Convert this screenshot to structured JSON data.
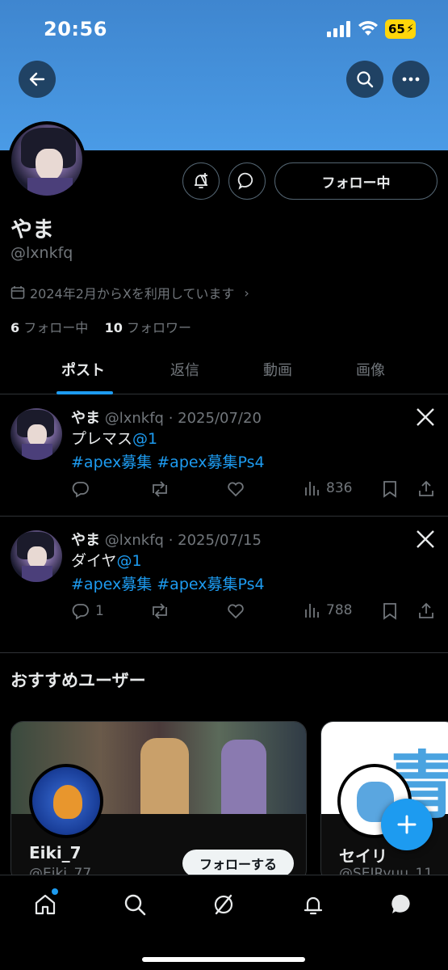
{
  "status_bar": {
    "time": "20:56",
    "battery": "65"
  },
  "profile": {
    "display_name": "やま",
    "handle": "@lxnkfq",
    "joined": "2024年2月からXを利用しています",
    "following_count": "6",
    "following_label": "フォロー中",
    "followers_count": "10",
    "followers_label": "フォロワー",
    "following_button": "フォロー中"
  },
  "tabs": [
    {
      "label": "ポスト"
    },
    {
      "label": "返信"
    },
    {
      "label": "動画"
    },
    {
      "label": "画像"
    }
  ],
  "posts": [
    {
      "name": "やま",
      "meta": "@lxnkfq · 2025/07/20",
      "text": "プレマス",
      "mention": "@1",
      "hashtags": "#apex募集 #apex募集Ps4",
      "replies": "",
      "views": "836"
    },
    {
      "name": "やま",
      "meta": "@lxnkfq · 2025/07/15",
      "text": "ダイヤ",
      "mention": "@1",
      "hashtags": "#apex募集 #apex募集Ps4",
      "replies": "1",
      "views": "788"
    }
  ],
  "recommended": {
    "title": "おすすめユーザー",
    "users": [
      {
        "name": "Eiki_7",
        "handle": "@Eiki_77",
        "follow_label": "フォローする"
      },
      {
        "name": "セイリ",
        "handle": "@SEIRyuu_11",
        "banner_text": "青"
      }
    ]
  },
  "colors": {
    "accent": "#1d9bf0",
    "banner": "#4a9be6",
    "background": "#000000"
  },
  "icons": [
    "back-icon",
    "search-icon",
    "more-icon",
    "notify-add-icon",
    "message-icon",
    "calendar-icon",
    "x-logo-icon",
    "reply-icon",
    "repost-icon",
    "like-icon",
    "views-icon",
    "bookmark-icon",
    "share-icon",
    "compose-icon",
    "home-icon",
    "grok-icon",
    "bell-icon",
    "messages-icon"
  ]
}
